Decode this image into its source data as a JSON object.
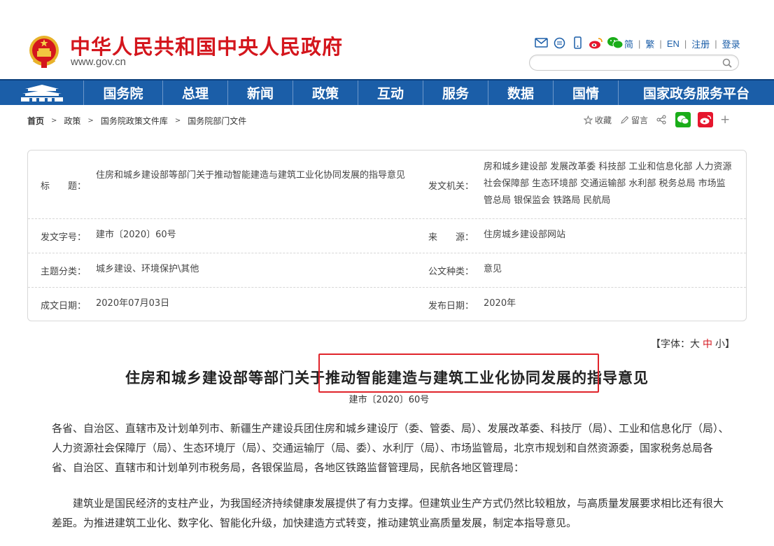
{
  "header": {
    "site_title": "中华人民共和国中央人民政府",
    "site_url": "www.gov.cn",
    "links": [
      "简",
      "繁",
      "EN",
      "注册",
      "登录"
    ],
    "icons": [
      "mail-icon",
      "chat-icon",
      "mobile-icon",
      "weibo-icon",
      "wechat-icon"
    ]
  },
  "nav": {
    "items": [
      "国务院",
      "总理",
      "新闻",
      "政策",
      "互动",
      "服务",
      "数据",
      "国情",
      "国家政务服务平台"
    ]
  },
  "breadcrumb": [
    "首页",
    "政策",
    "国务院政策文件库",
    "国务院部门文件"
  ],
  "tools": {
    "favorite": "收藏",
    "comment": "留言",
    "plus": "+"
  },
  "info": {
    "title_label": "标　　题：",
    "title_value": "住房和城乡建设部等部门关于推动智能建造与建筑工业化协同发展的指导意见",
    "issuer_label": "发文机关：",
    "issuer_value": "房和城乡建设部 发展改革委 科技部 工业和信息化部 人力资源社会保障部 生态环境部 交通运输部 水利部 税务总局 市场监管总局 银保监会 铁路局 民航局",
    "docno_label": "发文字号：",
    "docno_value": "建市〔2020〕60号",
    "source_label": "来　　源：",
    "source_value": "住房城乡建设部网站",
    "topic_label": "主题分类：",
    "topic_value": "城乡建设、环境保护\\其他",
    "type_label": "公文种类：",
    "type_value": "意见",
    "date_label": "成文日期：",
    "date_value": "2020年07月03日",
    "pub_label": "发布日期：",
    "pub_value": "2020年"
  },
  "fontsize": {
    "open": "【字体：",
    "big": "大",
    "mid": "中",
    "small": "小",
    "close": "】"
  },
  "document": {
    "title": "住房和城乡建设部等部门关于推动智能建造与建筑工业化协同发展的指导意见",
    "doc_no": "建市〔2020〕60号",
    "para1": "各省、自治区、直辖市及计划单列市、新疆生产建设兵团住房和城乡建设厅（委、管委、局）、发展改革委、科技厅（局）、工业和信息化厅（局）、人力资源社会保障厅（局）、生态环境厅（局）、交通运输厅（局、委）、水利厅（局）、市场监管局，北京市规划和自然资源委，国家税务总局各省、自治区、直辖市和计划单列市税务局，各银保监局，各地区铁路监督管理局，民航各地区管理局：",
    "para2": "建筑业是国民经济的支柱产业，为我国经济持续健康发展提供了有力支撑。但建筑业生产方式仍然比较粗放，与高质量发展要求相比还有很大差距。为推进建筑工业化、数字化、智能化升级，加快建造方式转变，推动建筑业高质量发展，制定本指导意见。"
  },
  "colors": {
    "brand_red": "#d4161d",
    "nav_blue": "#1b5ea8",
    "highlight": "#e0242b"
  }
}
